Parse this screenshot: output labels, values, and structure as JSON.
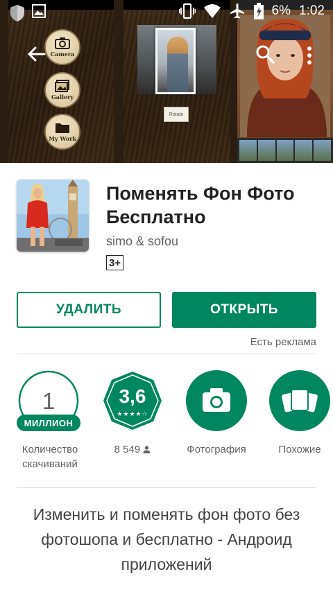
{
  "status_bar": {
    "battery": "6%",
    "time": "1:02",
    "icons": [
      "shield-icon",
      "image-icon",
      "vibrate-icon",
      "wifi-icon",
      "airplane-icon",
      "battery-icon"
    ]
  },
  "screenshots": {
    "shot1_buttons": [
      "Camera",
      "Gallery",
      "My Work"
    ],
    "shot2_rotate": "Rotate"
  },
  "app": {
    "title": "Поменять Фон Фото Бесплатно",
    "developer": "simo & sofou",
    "age_rating": "3+"
  },
  "actions": {
    "uninstall_label": "УДАЛИТЬ",
    "open_label": "ОТКРЫТЬ",
    "ads_note": "Есть реклама"
  },
  "stats": {
    "downloads": {
      "value": "1",
      "badge": "МИЛЛИОН",
      "label": "Количество скачиваний"
    },
    "rating": {
      "value": "3,6",
      "stars": 3.6,
      "count": "8 549",
      "label": "8 549"
    },
    "category": {
      "label": "Фотография",
      "icon": "camera-icon"
    },
    "similar": {
      "label": "Похожие",
      "icon": "cards-icon"
    }
  },
  "description": "Изменить и поменять фон фото без фотошопа и бесплатно - Андроид приложений",
  "colors": {
    "accent": "#01875f",
    "text_primary": "#212121",
    "text_secondary": "#616161"
  }
}
